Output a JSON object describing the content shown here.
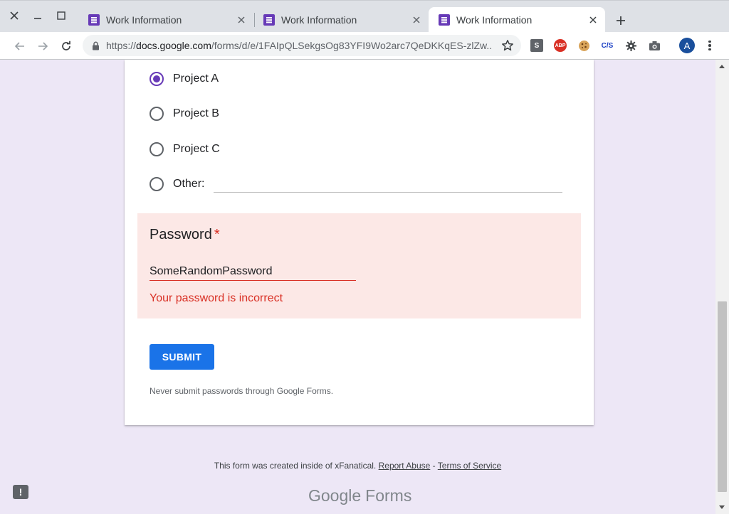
{
  "browser": {
    "tabs": [
      {
        "title": "Work Information",
        "active": false
      },
      {
        "title": "Work Information",
        "active": false
      },
      {
        "title": "Work Information",
        "active": true
      }
    ],
    "url": {
      "scheme": "https://",
      "host": "docs.google.com",
      "path": "/forms/d/e/1FAIpQLSekgsOg83YFI9Wo2arc7QeDKKqES-zlZw..."
    },
    "extensions": [
      {
        "icon": "s-extension-icon",
        "label": "S"
      },
      {
        "icon": "adblock-icon",
        "label": "ABP"
      },
      {
        "icon": "cookie-icon",
        "label": ""
      },
      {
        "icon": "css-js-icon",
        "label": "C/S"
      },
      {
        "icon": "gear-bug-icon",
        "label": ""
      },
      {
        "icon": "camera-icon",
        "label": ""
      }
    ],
    "avatar_letter": "A"
  },
  "form": {
    "options": [
      {
        "label": "Project A",
        "checked": true
      },
      {
        "label": "Project B",
        "checked": false
      },
      {
        "label": "Project C",
        "checked": false
      },
      {
        "label": "Other:",
        "checked": false
      }
    ],
    "password": {
      "title": "Password",
      "required_mark": "*",
      "value": "SomeRandomPassword",
      "error": "Your password is incorrect"
    },
    "submit_label": "SUBMIT",
    "warning": "Never submit passwords through Google Forms."
  },
  "footer": {
    "text": "This form was created inside of xFanatical.",
    "report_abuse": "Report Abuse",
    "separator": "-",
    "terms": "Terms of Service",
    "brand_google": "Google",
    "brand_forms": "Forms"
  },
  "colors": {
    "accent": "#673ab7",
    "error": "#d93025",
    "error_bg": "#fce8e6",
    "submit": "#1a73e8",
    "page_bg": "#ede7f6"
  }
}
